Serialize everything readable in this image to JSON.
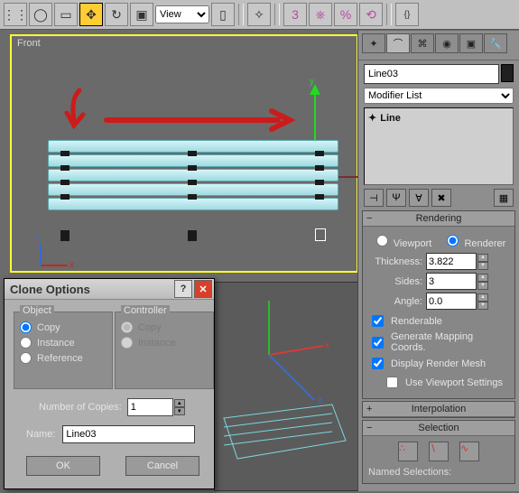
{
  "toolbar": {
    "view_dropdown": "View"
  },
  "viewport": {
    "label": "Front",
    "axis_x": "x",
    "axis_y": "y",
    "axis_z": "z"
  },
  "clone_dialog": {
    "title": "Clone Options",
    "group_object": "Object",
    "group_controller": "Controller",
    "opt_copy": "Copy",
    "opt_instance": "Instance",
    "opt_reference": "Reference",
    "num_copies_label": "Number of Copies:",
    "num_copies_value": "1",
    "name_label": "Name:",
    "name_value": "Line03",
    "ok": "OK",
    "cancel": "Cancel"
  },
  "rpanel": {
    "object_name": "Line03",
    "modifier_list_label": "Modifier List",
    "stack_item": "Line",
    "render_rollout": "Rendering",
    "radio_viewport": "Viewport",
    "radio_renderer": "Renderer",
    "thickness_label": "Thickness:",
    "thickness_value": "3.822",
    "sides_label": "Sides:",
    "sides_value": "3",
    "angle_label": "Angle:",
    "angle_value": "0.0",
    "chk_renderable": "Renderable",
    "chk_genmap": "Generate Mapping Coords.",
    "chk_display": "Display Render Mesh",
    "chk_useview": "Use Viewport Settings",
    "interp_rollout": "Interpolation",
    "selection_rollout": "Selection",
    "named_sel_label": "Named Selections:"
  }
}
